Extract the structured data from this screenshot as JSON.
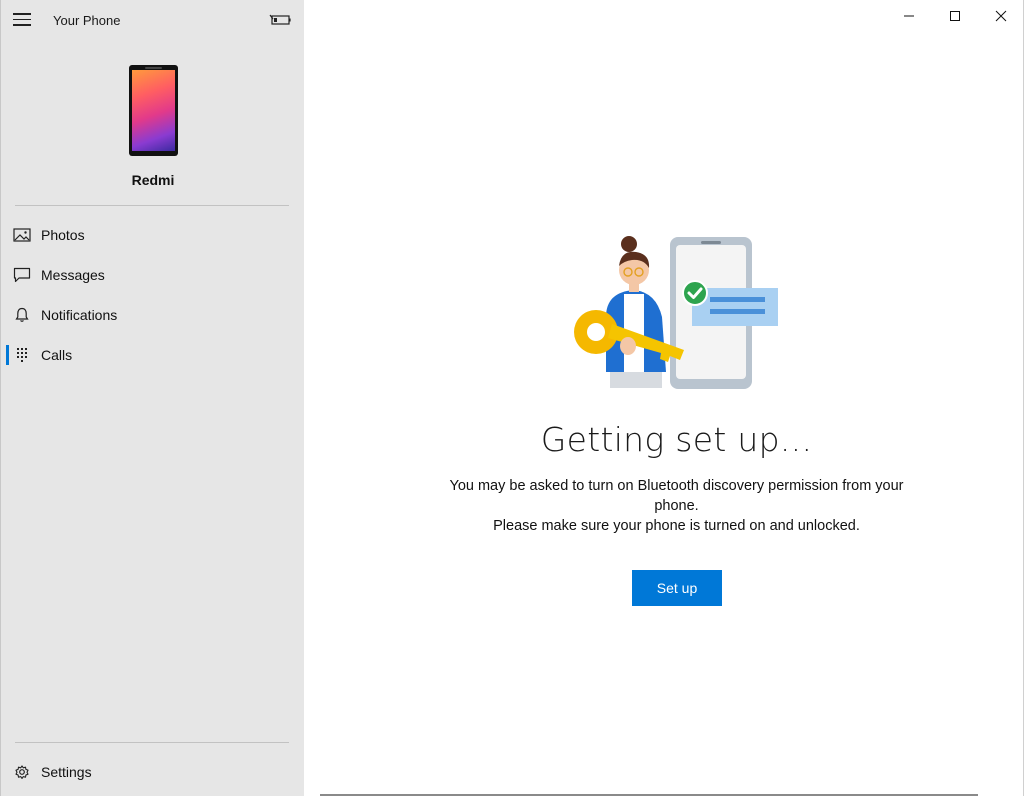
{
  "app": {
    "title": "Your Phone"
  },
  "device": {
    "name": "Redmi"
  },
  "nav": {
    "items": [
      {
        "label": "Photos",
        "icon": "photos-icon"
      },
      {
        "label": "Messages",
        "icon": "messages-icon"
      },
      {
        "label": "Notifications",
        "icon": "bell-icon"
      },
      {
        "label": "Calls",
        "icon": "dialpad-icon",
        "active": true
      }
    ],
    "settings_label": "Settings"
  },
  "main": {
    "heading": "Getting set up...",
    "desc_line1": "You may be asked to turn on Bluetooth discovery permission from your phone.",
    "desc_line2": "Please make sure your phone is turned on and unlocked.",
    "setup_label": "Set up"
  },
  "colors": {
    "accent": "#0078d7",
    "sidebar": "#e6e6e6",
    "check": "#2ea44f",
    "key": "#f5b800"
  }
}
